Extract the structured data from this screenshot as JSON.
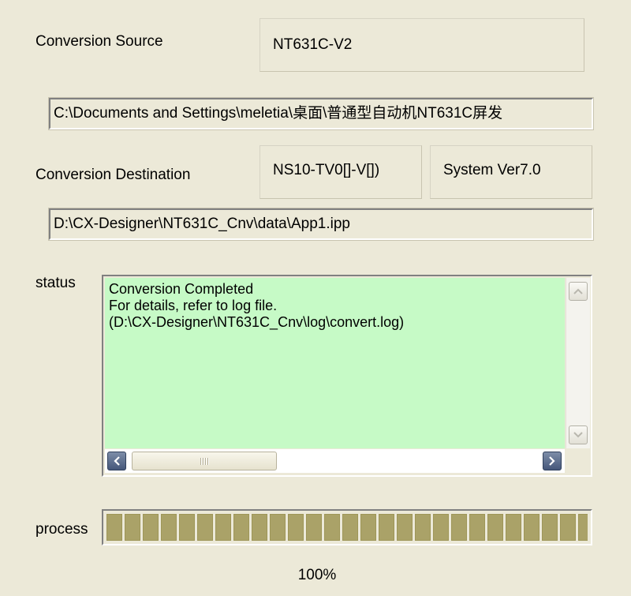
{
  "conversion_source": {
    "label": "Conversion Source",
    "model": "NT631C-V2",
    "path": "C:\\Documents and Settings\\meletia\\桌面\\普通型自动机NT631C屏发"
  },
  "conversion_destination": {
    "label": "Conversion Destination",
    "model": "NS10-TV0[]-V[])",
    "system_version": "System Ver7.0",
    "path": "D:\\CX-Designer\\NT631C_Cnv\\data\\App1.ipp"
  },
  "status": {
    "label": "status",
    "lines": [
      "Conversion Completed",
      "For details, refer to log file.",
      "(D:\\CX-Designer\\NT631C_Cnv\\log\\convert.log)"
    ],
    "icons": {
      "up": "scroll-up-arrow-icon",
      "down": "scroll-down-arrow-icon",
      "left": "scroll-left-arrow-icon",
      "right": "scroll-right-arrow-icon"
    }
  },
  "process": {
    "label": "process",
    "progress": 1.0,
    "percent_text": "100%"
  },
  "colors": {
    "window_bg": "#ECE9D8",
    "status_bg": "#C6FAC6",
    "progress_fill": "#AAA268"
  }
}
